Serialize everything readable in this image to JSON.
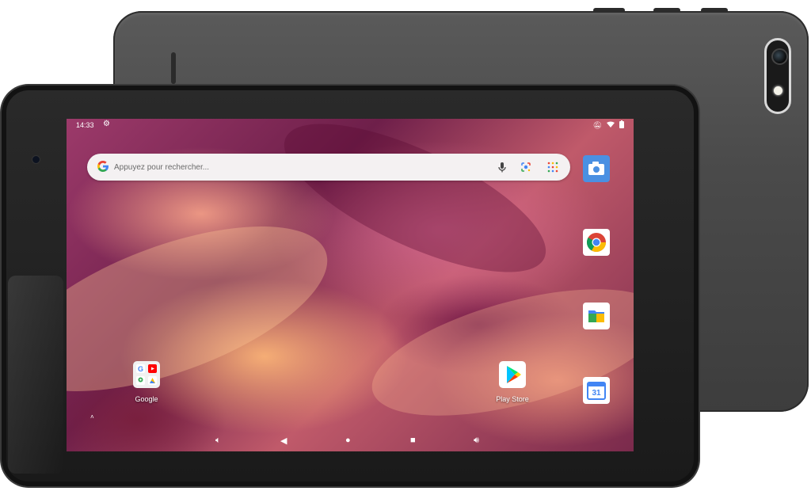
{
  "status_bar": {
    "time": "14:33",
    "left_icons": [
      "settings-gear-icon"
    ],
    "right_icons": [
      "notifications-muted-icon",
      "wifi-icon",
      "battery-icon"
    ]
  },
  "search": {
    "placeholder": "Appuyez pour rechercher...",
    "value": "",
    "icons": [
      "google-g-icon",
      "microphone-icon",
      "google-lens-icon",
      "apps-grid-icon"
    ]
  },
  "side_dock": [
    {
      "icon": "camera-icon",
      "label": ""
    },
    {
      "icon": "chrome-icon",
      "label": ""
    },
    {
      "icon": "files-icon",
      "label": ""
    },
    {
      "icon": "calendar-icon",
      "label": "",
      "day": "31"
    }
  ],
  "home_apps": [
    {
      "icon": "google-folder-icon",
      "label": "Google"
    },
    {
      "icon": "play-store-icon",
      "label": "Play Store"
    }
  ],
  "nav_bar": {
    "items": [
      "volume-down-icon",
      "back-icon",
      "home-icon",
      "recents-icon",
      "volume-up-icon"
    ]
  },
  "colors": {
    "wallpaper_primary": "#9c3a6a",
    "wallpaper_accent": "#ffb97a",
    "bezel": "#1a1a1a",
    "back_case": "#4a4a4a"
  }
}
